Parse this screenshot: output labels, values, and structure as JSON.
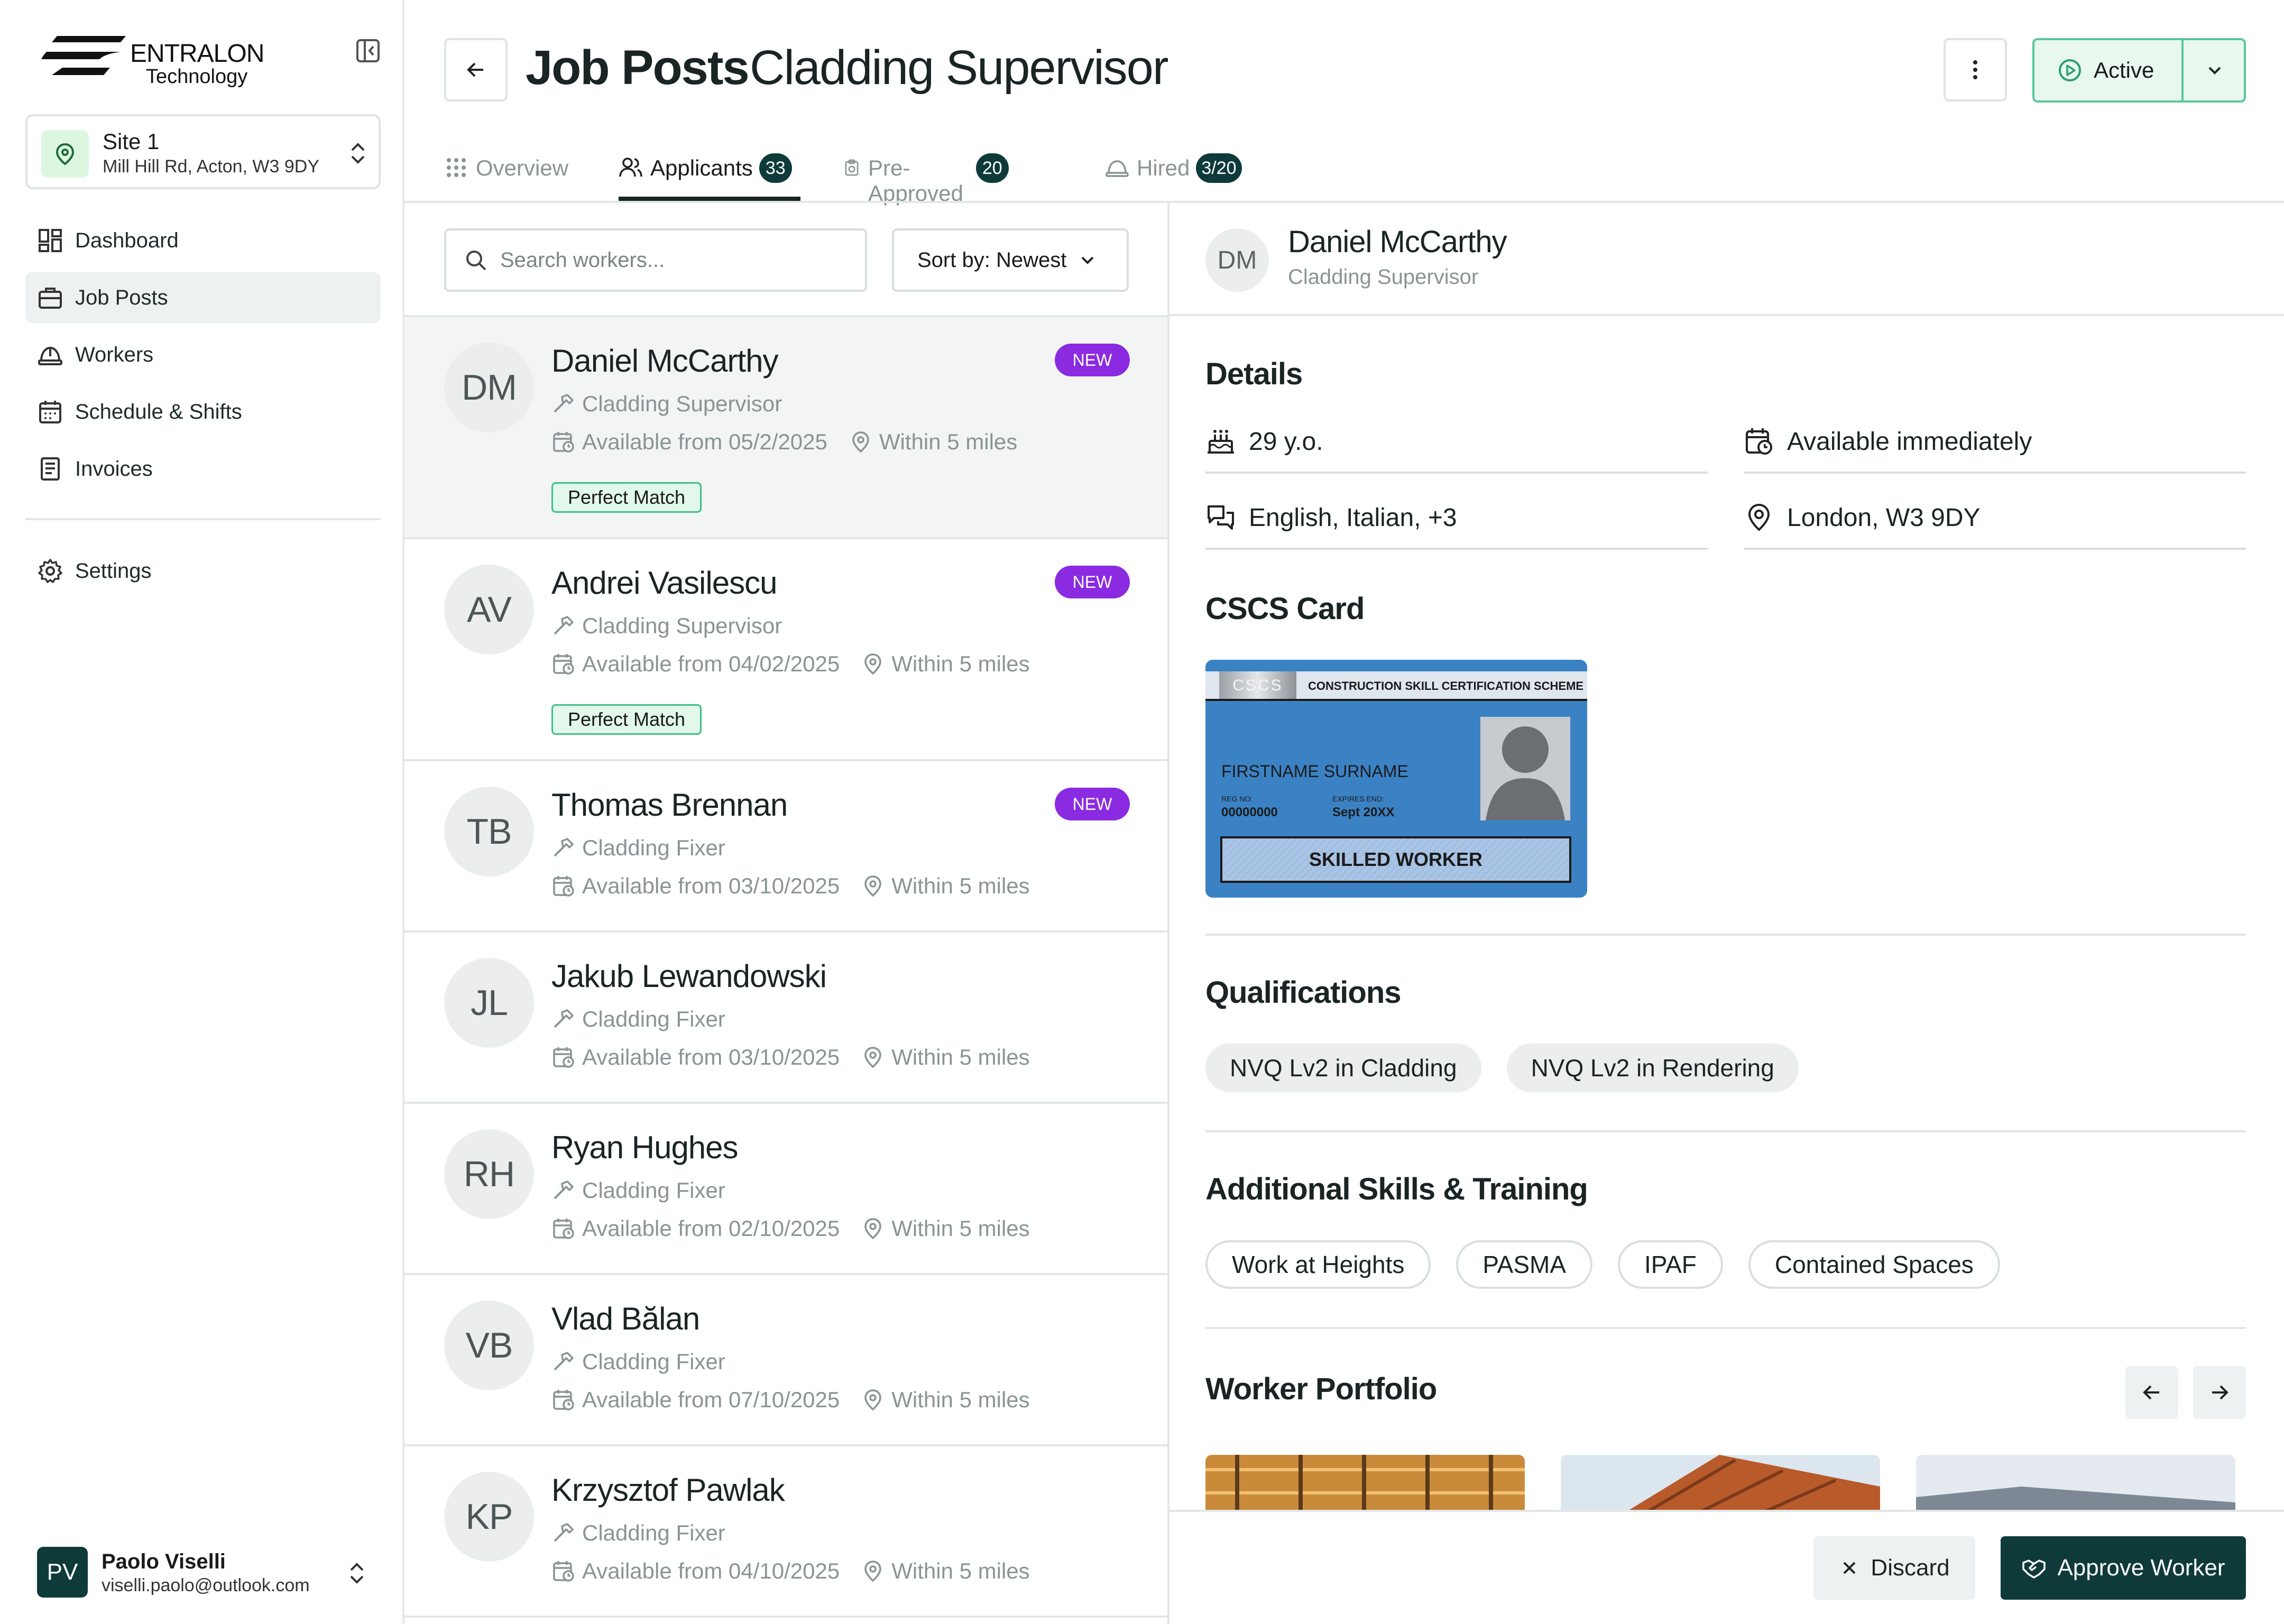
{
  "brand": {
    "name_line1": "ENTRALON",
    "name_line2": "Technology"
  },
  "site": {
    "name": "Site 1",
    "address": "Mill Hill Rd, Acton, W3 9DY"
  },
  "nav": [
    {
      "label": "Dashboard",
      "icon": "dashboard-icon"
    },
    {
      "label": "Job Posts",
      "icon": "briefcase-icon",
      "active": true
    },
    {
      "label": "Workers",
      "icon": "hard-hat-icon"
    },
    {
      "label": "Schedule & Shifts",
      "icon": "calendar-icon"
    },
    {
      "label": "Invoices",
      "icon": "invoice-icon"
    }
  ],
  "settings_label": "Settings",
  "user": {
    "initials": "PV",
    "name": "Paolo Viselli",
    "email": "viselli.paolo@outlook.com"
  },
  "header": {
    "title": "Job Posts",
    "subtitle": "Cladding Supervisor",
    "status": "Active"
  },
  "tabs": [
    {
      "label": "Overview",
      "badge": ""
    },
    {
      "label": "Applicants",
      "badge": "33",
      "active": true
    },
    {
      "label": "Pre-Approved",
      "badge": "20"
    },
    {
      "label": "Hired",
      "badge": "3/20"
    }
  ],
  "search": {
    "placeholder": "Search workers..."
  },
  "sort": {
    "label": "Sort by: Newest"
  },
  "applicants": [
    {
      "initials": "DM",
      "name": "Daniel McCarthy",
      "role": "Cladding Supervisor",
      "available": "Available from 05/2/2025",
      "distance": "Within 5 miles",
      "tag": "Perfect Match",
      "badge": "NEW",
      "selected": true
    },
    {
      "initials": "AV",
      "name": "Andrei Vasilescu",
      "role": "Cladding Supervisor",
      "available": "Available from 04/02/2025",
      "distance": "Within 5 miles",
      "tag": "Perfect Match",
      "badge": "NEW"
    },
    {
      "initials": "TB",
      "name": "Thomas Brennan",
      "role": "Cladding Fixer",
      "available": "Available from 03/10/2025",
      "distance": "Within 5 miles",
      "tag": "",
      "badge": "NEW"
    },
    {
      "initials": "JL",
      "name": "Jakub Lewandowski",
      "role": "Cladding Fixer",
      "available": "Available from 03/10/2025",
      "distance": "Within 5 miles",
      "tag": "",
      "badge": ""
    },
    {
      "initials": "RH",
      "name": "Ryan Hughes",
      "role": "Cladding Fixer",
      "available": "Available from 02/10/2025",
      "distance": "Within 5 miles",
      "tag": "",
      "badge": ""
    },
    {
      "initials": "VB",
      "name": "Vlad Bălan",
      "role": "Cladding Fixer",
      "available": "Available from 07/10/2025",
      "distance": "Within 5 miles",
      "tag": "",
      "badge": ""
    },
    {
      "initials": "KP",
      "name": "Krzysztof Pawlak",
      "role": "Cladding Fixer",
      "available": "Available from 04/10/2025",
      "distance": "Within 5 miles",
      "tag": "",
      "badge": ""
    }
  ],
  "detail": {
    "initials": "DM",
    "name": "Daniel McCarthy",
    "role": "Cladding Supervisor",
    "details_title": "Details",
    "age": "29 y.o.",
    "availability": "Available immediately",
    "languages": "English, Italian, +3",
    "location": "London, W3 9DY",
    "cscs_title": "CSCS Card",
    "cscs": {
      "logo": "CSCS",
      "scheme": "CONSTRUCTION SKILL CERTIFICATION SCHEME",
      "holder": "FIRSTNAME SURNAME",
      "reg_label": "REG NO:",
      "reg_no": "00000000",
      "expiry_label": "EXPIRES END:",
      "expiry": "Sept 20XX",
      "level": "SKILLED WORKER"
    },
    "qualifications_title": "Qualifications",
    "qualifications": [
      "NVQ Lv2 in Cladding",
      "NVQ Lv2 in Rendering"
    ],
    "skills_title": "Additional Skills & Training",
    "skills": [
      "Work at Heights",
      "PASMA",
      "IPAF",
      "Contained Spaces"
    ],
    "portfolio_title": "Worker Portfolio"
  },
  "actions": {
    "discard": "Discard",
    "approve": "Approve Worker"
  },
  "colors": {
    "brand_dark": "#0f3a3a",
    "accent_green": "#59c79b",
    "new_badge": "#8a2be2",
    "cscs_blue": "#3b82c4"
  }
}
